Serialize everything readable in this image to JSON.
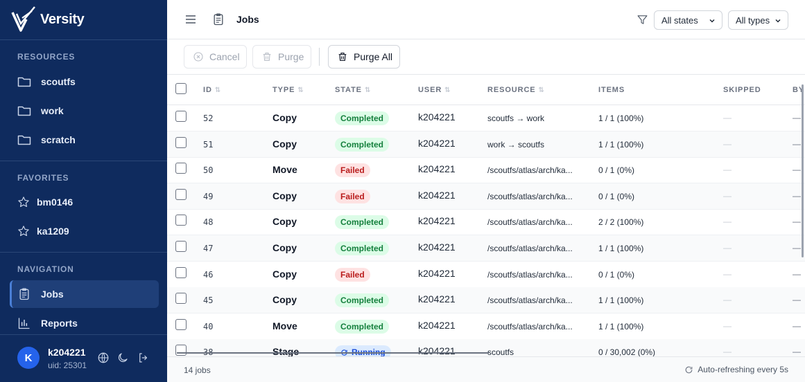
{
  "app": {
    "name": "Versity"
  },
  "sidebar": {
    "resources_heading": "RESOURCES",
    "resources": [
      {
        "label": "scoutfs",
        "icon": "folder-icon"
      },
      {
        "label": "work",
        "icon": "folder-icon"
      },
      {
        "label": "scratch",
        "icon": "folder-icon"
      }
    ],
    "favorites_heading": "FAVORITES",
    "favorites": [
      {
        "label": "bm0146",
        "icon": "star-icon"
      },
      {
        "label": "ka1209",
        "icon": "star-icon"
      }
    ],
    "navigation_heading": "NAVIGATION",
    "navigation": [
      {
        "label": "Jobs",
        "icon": "clipboard-icon",
        "active": true
      },
      {
        "label": "Reports",
        "icon": "bar-chart-icon",
        "active": false
      }
    ]
  },
  "user": {
    "initial": "K",
    "name": "k204221",
    "uid": "uid: 25301"
  },
  "header": {
    "title": "Jobs",
    "state_filter": "All states",
    "type_filter": "All types"
  },
  "toolbar": {
    "cancel_label": "Cancel",
    "purge_label": "Purge",
    "purge_all_label": "Purge All"
  },
  "table": {
    "columns": {
      "id": "ID",
      "type": "TYPE",
      "state": "STATE",
      "user": "USER",
      "resource": "RESOURCE",
      "items": "ITEMS",
      "skipped": "SKIPPED",
      "by": "BY"
    },
    "rows": [
      {
        "id": "52",
        "type": "Copy",
        "state": "Completed",
        "state_kind": "completed",
        "user": "k204221",
        "resource": "scoutfs → work",
        "items": "1 / 1 (100%)",
        "skipped": "—",
        "by": "—"
      },
      {
        "id": "51",
        "type": "Copy",
        "state": "Completed",
        "state_kind": "completed",
        "user": "k204221",
        "resource": "work → scoutfs",
        "items": "1 / 1 (100%)",
        "skipped": "—",
        "by": "—"
      },
      {
        "id": "50",
        "type": "Move",
        "state": "Failed",
        "state_kind": "failed",
        "user": "k204221",
        "resource": "/scoutfs/atlas/arch/ka...",
        "items": "0 / 1 (0%)",
        "skipped": "—",
        "by": "—"
      },
      {
        "id": "49",
        "type": "Copy",
        "state": "Failed",
        "state_kind": "failed",
        "user": "k204221",
        "resource": "/scoutfs/atlas/arch/ka...",
        "items": "0 / 1 (0%)",
        "skipped": "—",
        "by": "—"
      },
      {
        "id": "48",
        "type": "Copy",
        "state": "Completed",
        "state_kind": "completed",
        "user": "k204221",
        "resource": "/scoutfs/atlas/arch/ka...",
        "items": "2 / 2 (100%)",
        "skipped": "—",
        "by": "—"
      },
      {
        "id": "47",
        "type": "Copy",
        "state": "Completed",
        "state_kind": "completed",
        "user": "k204221",
        "resource": "/scoutfs/atlas/arch/ka...",
        "items": "1 / 1 (100%)",
        "skipped": "—",
        "by": "—"
      },
      {
        "id": "46",
        "type": "Copy",
        "state": "Failed",
        "state_kind": "failed",
        "user": "k204221",
        "resource": "/scoutfs/atlas/arch/ka...",
        "items": "0 / 1 (0%)",
        "skipped": "—",
        "by": "—"
      },
      {
        "id": "45",
        "type": "Copy",
        "state": "Completed",
        "state_kind": "completed",
        "user": "k204221",
        "resource": "/scoutfs/atlas/arch/ka...",
        "items": "1 / 1 (100%)",
        "skipped": "—",
        "by": "—"
      },
      {
        "id": "40",
        "type": "Move",
        "state": "Completed",
        "state_kind": "completed",
        "user": "k204221",
        "resource": "/scoutfs/atlas/arch/ka...",
        "items": "1 / 1 (100%)",
        "skipped": "—",
        "by": "—"
      },
      {
        "id": "38",
        "type": "Stage",
        "state": "Running",
        "state_kind": "running",
        "user": "k204221",
        "resource": "scoutfs",
        "items": "0 / 30,002 (0%)",
        "skipped": "—",
        "by": "—"
      }
    ]
  },
  "footer": {
    "count": "14 jobs",
    "refresh": "Auto-refreshing every 5s"
  }
}
